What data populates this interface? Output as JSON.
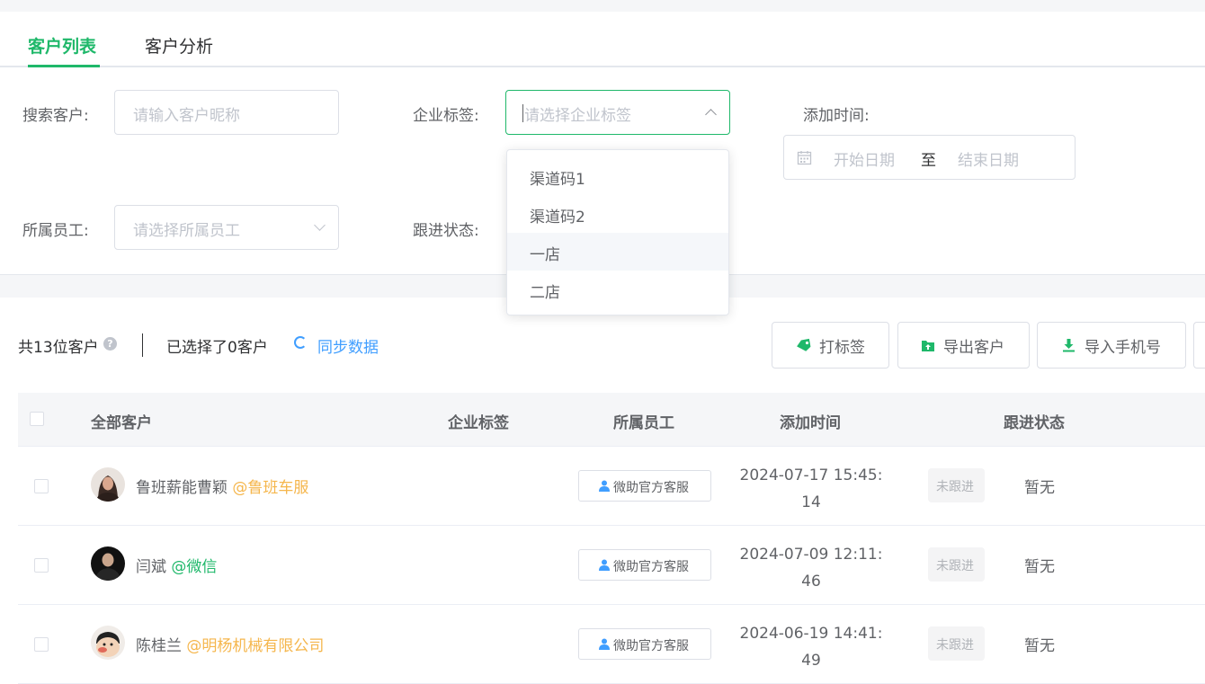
{
  "colors": {
    "accent": "#1fb86a",
    "link": "#409eff",
    "corp_orange": "#f5b64c",
    "corp_green": "#1fb86a"
  },
  "tabs": [
    {
      "label": "客户列表",
      "active": true
    },
    {
      "label": "客户分析",
      "active": false
    }
  ],
  "filters": {
    "search_label": "搜索客户:",
    "search_placeholder": "请输入客户昵称",
    "tag_label": "企业标签:",
    "tag_placeholder": "请选择企业标签",
    "add_time_label": "添加时间:",
    "start_placeholder": "开始日期",
    "range_sep": "至",
    "end_placeholder": "结束日期",
    "staff_label": "所属员工:",
    "staff_placeholder": "请选择所属员工",
    "follow_label": "跟进状态:"
  },
  "tag_dropdown": {
    "open": true,
    "options": [
      "渠道码1",
      "渠道码2",
      "一店",
      "二店"
    ],
    "hovered": "一店"
  },
  "summary": {
    "total": "共13位客户",
    "selected": "已选择了0客户",
    "sync": "同步数据"
  },
  "actions": {
    "tag": "打标签",
    "export": "导出客户",
    "import": "导入手机号"
  },
  "table": {
    "headers": {
      "customer": "全部客户",
      "tags": "企业标签",
      "staff": "所属员工",
      "time": "添加时间",
      "status": "跟进状态"
    },
    "rows": [
      {
        "name": "鲁班薪能曹颖",
        "corp": "@鲁班车服",
        "corp_color": "orange",
        "staff": "微助官方客服",
        "time": "2024-07-17 15:45:14",
        "badge": "未跟进",
        "status": "暂无",
        "avatar": "woman-photo"
      },
      {
        "name": "闫斌",
        "corp": "@微信",
        "corp_color": "green",
        "staff": "微助官方客服",
        "time": "2024-07-09 12:11:46",
        "badge": "未跟进",
        "status": "暂无",
        "avatar": "man-photo"
      },
      {
        "name": "陈桂兰",
        "corp": "@明杨机械有限公司",
        "corp_color": "orange",
        "staff": "微助官方客服",
        "time": "2024-06-19 14:41:49",
        "badge": "未跟进",
        "status": "暂无",
        "avatar": "cartoon-photo"
      }
    ]
  }
}
